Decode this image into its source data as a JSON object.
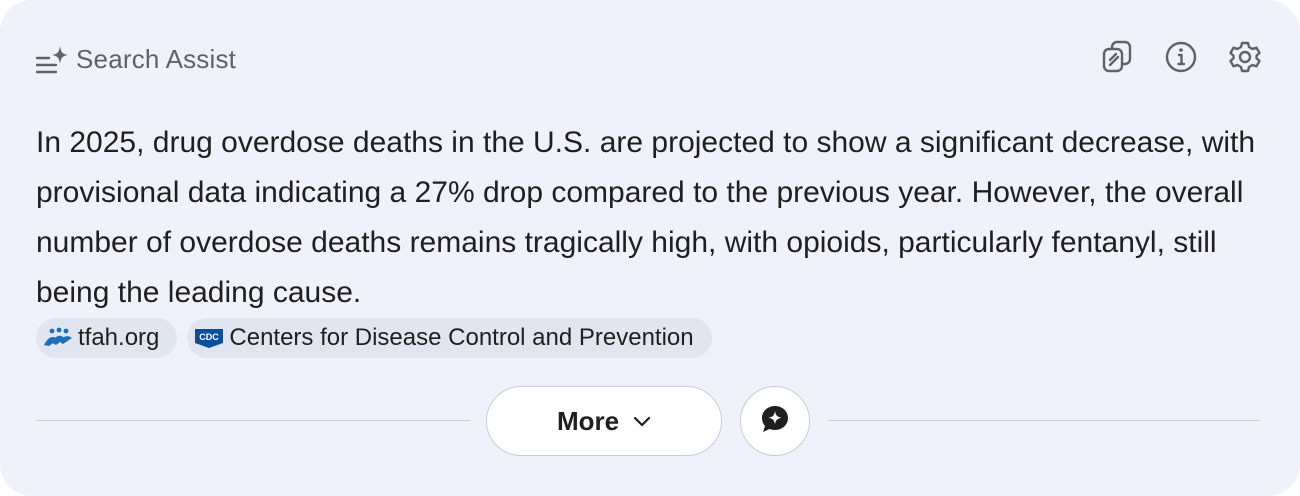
{
  "header": {
    "title": "Search Assist",
    "icon": "sparkle-list-icon"
  },
  "toolbar": {
    "icons": [
      "copy-icon",
      "info-icon",
      "settings-gear-icon"
    ]
  },
  "summary": {
    "text": "In 2025, drug overdose deaths in the U.S. are projected to show a significant decrease, with provisional data indicating a 27% drop compared to the previous year. However, the overall number of overdose deaths remains tragically high, with opioids, particularly fentanyl, still being the leading cause."
  },
  "sources": [
    {
      "label": "tfah.org",
      "icon": "tfah-logo-icon"
    },
    {
      "label": "Centers for Disease Control and Prevention",
      "icon": "cdc-logo-icon",
      "icon_text": "CDC"
    }
  ],
  "footer": {
    "more_label": "More",
    "chat_icon": "chat-sparkle-icon"
  },
  "colors": {
    "card_background": "#eff2fb",
    "chip_background": "#e1e5ef",
    "cdc_blue": "#0b4f9c",
    "tfah_blue": "#1d6fb8"
  }
}
